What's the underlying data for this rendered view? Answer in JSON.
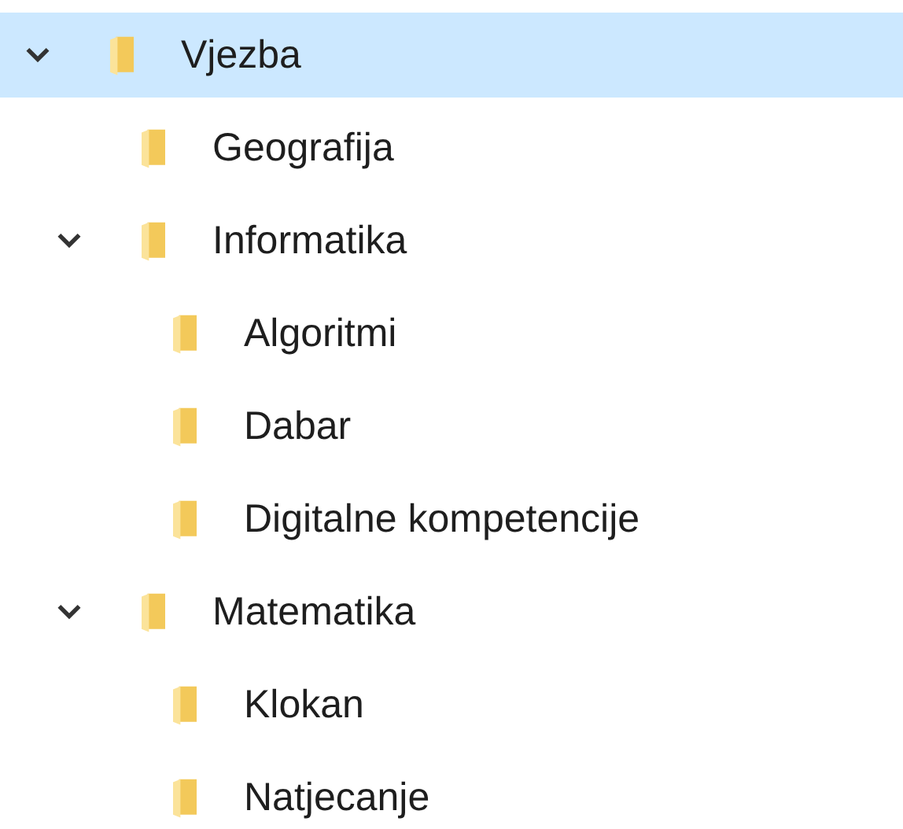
{
  "tree": [
    {
      "label": "Vjezba",
      "selected": true,
      "expanded": true,
      "children": [
        {
          "label": "Geografija",
          "selected": false
        },
        {
          "label": "Informatika",
          "selected": false,
          "expanded": true,
          "children": [
            {
              "label": "Algoritmi",
              "selected": false
            },
            {
              "label": "Dabar",
              "selected": false
            },
            {
              "label": "Digitalne kompetencije",
              "selected": false
            }
          ]
        },
        {
          "label": "Matematika",
          "selected": false,
          "expanded": true,
          "children": [
            {
              "label": "Klokan",
              "selected": false
            },
            {
              "label": "Natjecanje",
              "selected": false
            }
          ]
        }
      ]
    }
  ]
}
